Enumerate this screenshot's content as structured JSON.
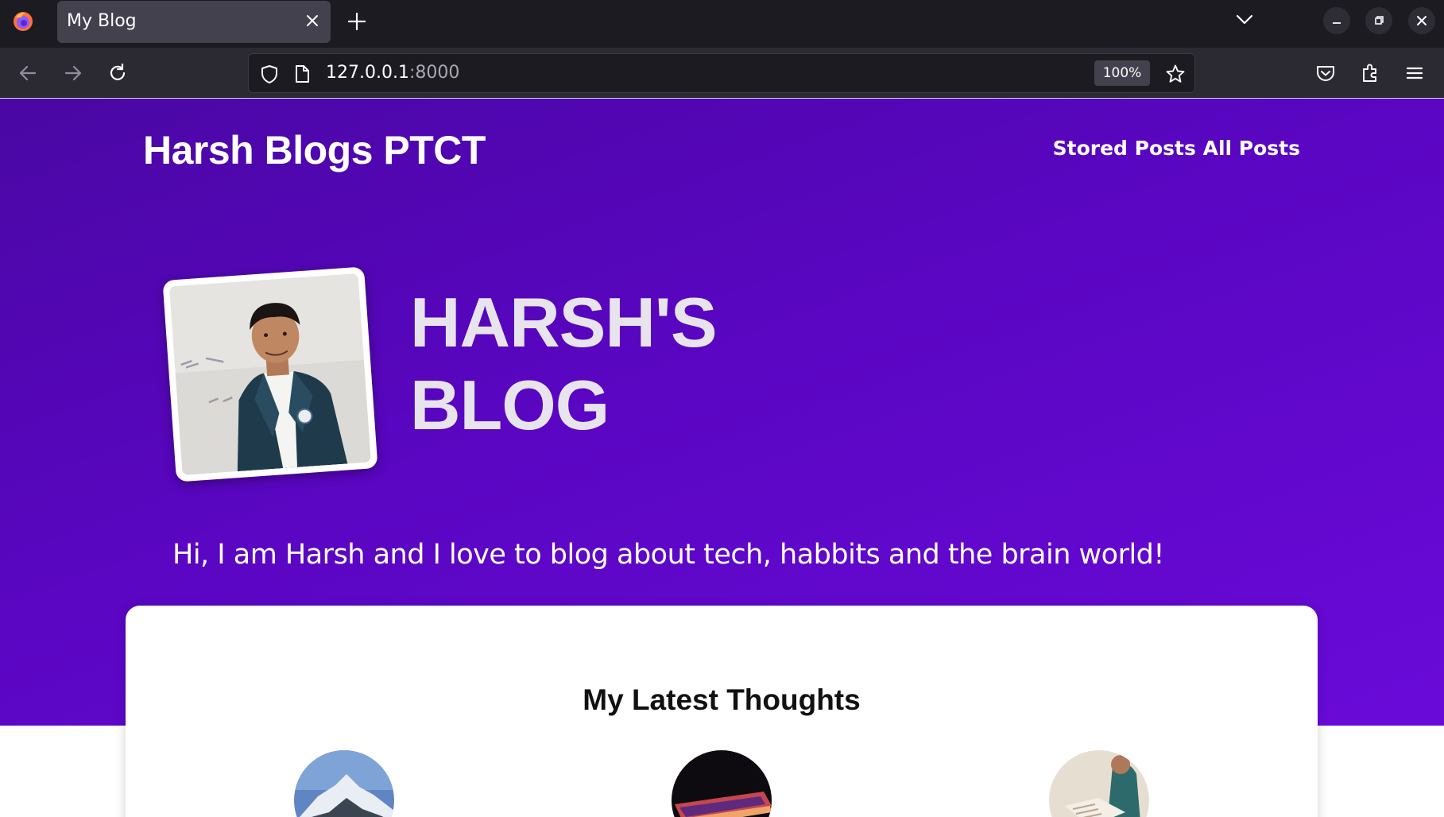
{
  "browser": {
    "tab_title": "My Blog",
    "url_host": "127.0.0.1",
    "url_port": ":8000",
    "zoom": "100%"
  },
  "site": {
    "title": "Harsh Blogs PTCT",
    "nav": [
      {
        "label": "Stored Posts"
      },
      {
        "label": "All Posts"
      }
    ]
  },
  "hero": {
    "heading_line1": "HARSH'S",
    "heading_line2": "BLOG",
    "tagline": "Hi, I am Harsh and I love to blog about tech, habbits and the brain world!"
  },
  "latest": {
    "title": "My Latest Thoughts",
    "posts": [
      {
        "image": "mountain"
      },
      {
        "image": "laptop"
      },
      {
        "image": "reading"
      }
    ]
  },
  "colors": {
    "hero_gradient_start": "#4a07a4",
    "hero_gradient_end": "#6a0ad9",
    "chrome_dark": "#1c1b22",
    "chrome_toolbar": "#2b2a33"
  }
}
